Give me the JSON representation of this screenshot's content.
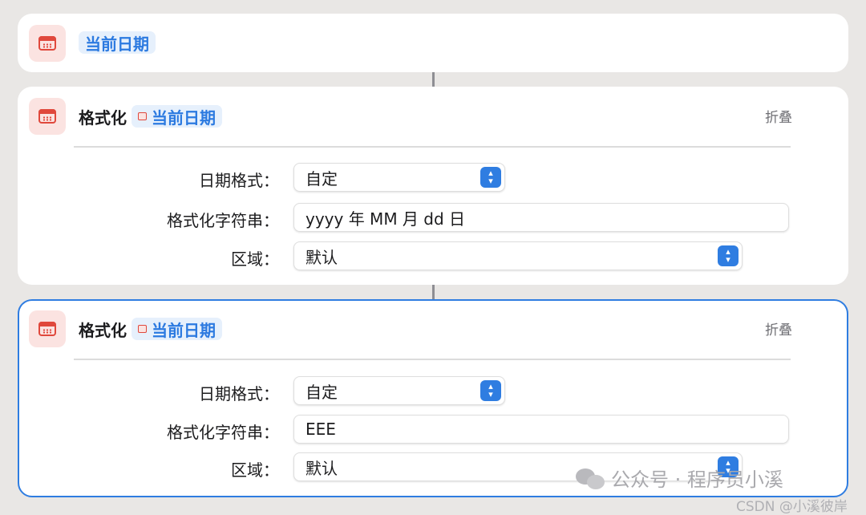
{
  "card1": {
    "var_token": "当前日期"
  },
  "card2": {
    "action_name": "格式化",
    "var_token": "当前日期",
    "collapse_label": "折叠",
    "date_format_label": "日期格式：",
    "date_format_value": "自定",
    "format_string_label": "格式化字符串：",
    "format_string_value": "yyyy 年 MM 月 dd 日",
    "locale_label": "区域：",
    "locale_value": "默认"
  },
  "card3": {
    "action_name": "格式化",
    "var_token": "当前日期",
    "collapse_label": "折叠",
    "date_format_label": "日期格式：",
    "date_format_value": "自定",
    "format_string_label": "格式化字符串：",
    "format_string_value": "EEE",
    "locale_label": "区域：",
    "locale_value": "默认"
  },
  "watermark": {
    "text": "公众号 · 程序员小溪",
    "csdn": "CSDN @小溪彼岸"
  },
  "colors": {
    "accent": "#2f7de1",
    "icon_red": "#e0483c",
    "background": "#e9e7e5"
  },
  "icons": {
    "action": "calendar-icon",
    "stepper": "chevron-up-down-icon"
  }
}
